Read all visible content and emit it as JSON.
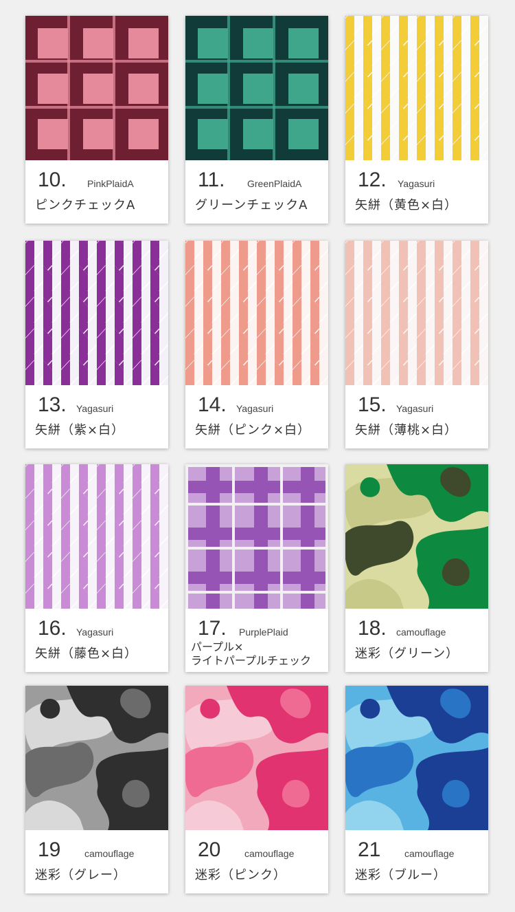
{
  "items": [
    {
      "number": "10.",
      "code": "PinkPlaidA",
      "name": "ピンクチェックA",
      "pattern": "plaid-squares",
      "colors": {
        "bg": "#6e1f31",
        "fg": "#e58a9b"
      }
    },
    {
      "number": "11.",
      "code": "GreenPlaidA",
      "name": "グリーンチェックA",
      "pattern": "plaid-squares",
      "colors": {
        "bg": "#113b38",
        "fg": "#3fa58b"
      }
    },
    {
      "number": "12.",
      "code": "Yagasuri",
      "name": "矢絣（黄色×白）",
      "pattern": "yagasuri",
      "colors": {
        "bg": "#fafaf8",
        "fg": "#f3cd38"
      }
    },
    {
      "number": "13.",
      "code": "Yagasuri",
      "name": "矢絣（紫×白）",
      "pattern": "yagasuri",
      "colors": {
        "bg": "#f5f1f8",
        "fg": "#8a2e98"
      }
    },
    {
      "number": "14.",
      "code": "Yagasuri",
      "name": "矢絣（ピンク×白）",
      "pattern": "yagasuri",
      "colors": {
        "bg": "#fbf4f3",
        "fg": "#ef9b8c"
      }
    },
    {
      "number": "15.",
      "code": "Yagasuri",
      "name": "矢絣（薄桃×白）",
      "pattern": "yagasuri",
      "colors": {
        "bg": "#fbf6f5",
        "fg": "#f2c1b5"
      }
    },
    {
      "number": "16.",
      "code": "Yagasuri",
      "name": "矢絣（藤色×白）",
      "pattern": "yagasuri",
      "colors": {
        "bg": "#f8f3fa",
        "fg": "#c98ad6"
      }
    },
    {
      "number": "17.",
      "code": "PurplePlaid",
      "name_lines": [
        "パープル×",
        "ライトパープルチェック"
      ],
      "pattern": "plaid-cross",
      "colors": {
        "bg": "#c7a1d7",
        "fg": "#9655b4",
        "line": "#f2f0f3"
      }
    },
    {
      "number": "18.",
      "code": "camouflage",
      "name": "迷彩（グリーン）",
      "pattern": "camo",
      "colors": {
        "c1": "#d9dba0",
        "c2": "#0d8a3f",
        "c3": "#3f4a2d",
        "c4": "#c6c987"
      }
    },
    {
      "number": "19",
      "code": "camouflage",
      "name": "迷彩（グレー）",
      "pattern": "camo",
      "colors": {
        "c1": "#9c9c9c",
        "c2": "#2f2f2f",
        "c3": "#6b6b6b",
        "c4": "#d9d9d9"
      }
    },
    {
      "number": "20",
      "code": "camouflage",
      "name": "迷彩（ピンク）",
      "pattern": "camo",
      "colors": {
        "c1": "#f2a9bb",
        "c2": "#e0336f",
        "c3": "#f06b94",
        "c4": "#f6cad6"
      }
    },
    {
      "number": "21",
      "code": "camouflage",
      "name": "迷彩（ブルー）",
      "pattern": "camo",
      "colors": {
        "c1": "#58b3e3",
        "c2": "#1c3f96",
        "c3": "#2a74c5",
        "c4": "#92d3ee"
      }
    }
  ]
}
